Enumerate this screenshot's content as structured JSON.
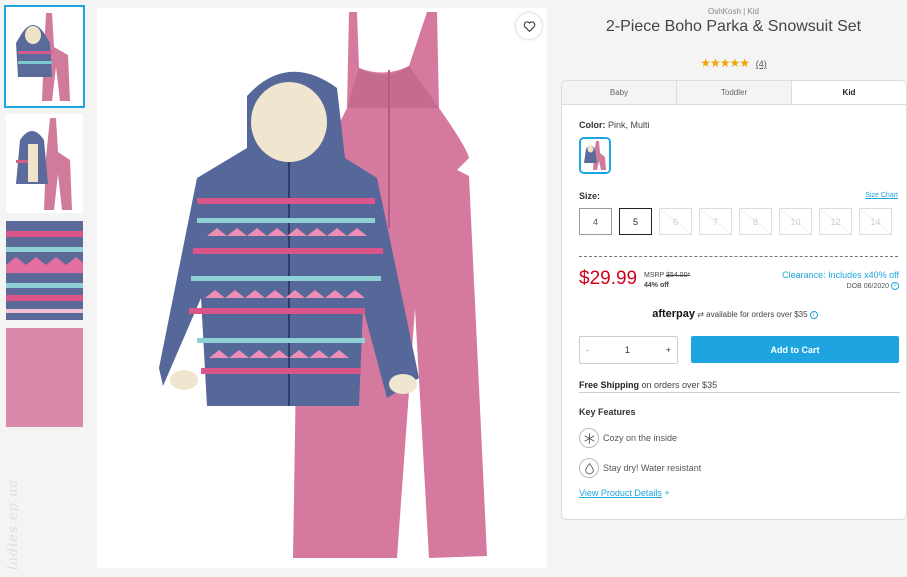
{
  "thumbnails": [
    {
      "label": "Parka and snowsuit front"
    },
    {
      "label": "Parka open with snowsuit"
    },
    {
      "label": "Parka print detail"
    },
    {
      "label": "Snowsuit fabric detail"
    }
  ],
  "watermark": "ladies.ep.ua",
  "product": {
    "brand": "OshKosh | Kid",
    "title": "2-Piece Boho Parka & Snowsuit Set",
    "stars": "★★★★★",
    "review_count": "(4)"
  },
  "tabs": [
    "Baby",
    "Toddler",
    "Kid"
  ],
  "active_tab": "Kid",
  "color": {
    "label": "Color:",
    "value": "Pink, Multi"
  },
  "size": {
    "label": "Size:",
    "chart_link": "Size Chart",
    "options": [
      {
        "label": "4",
        "state": "available"
      },
      {
        "label": "5",
        "state": "selected"
      },
      {
        "label": "6",
        "state": "unavailable"
      },
      {
        "label": "7",
        "state": "unavailable"
      },
      {
        "label": "8",
        "state": "unavailable"
      },
      {
        "label": "10",
        "state": "unavailable"
      },
      {
        "label": "12",
        "state": "unavailable"
      },
      {
        "label": "14",
        "state": "unavailable"
      }
    ]
  },
  "pricing": {
    "price": "$29.99",
    "msrp_label": "MSRP",
    "msrp_value": "$54.00*",
    "discount": "44% off",
    "clearance": "Clearance: Includes x40% off",
    "dob": "DOB 06/2020"
  },
  "afterpay": {
    "logo": "afterpay",
    "text": "available for orders over $35"
  },
  "quantity": {
    "minus": "-",
    "value": "1",
    "plus": "+"
  },
  "add_to_cart": "Add to Cart",
  "shipping": {
    "bold": "Free Shipping",
    "rest": "on orders over $35"
  },
  "key_features": {
    "title": "Key Features",
    "items": [
      {
        "icon": "snowflake-icon",
        "text": "Cozy on the inside"
      },
      {
        "icon": "water-drop-icon",
        "text": "Stay dry! Water resistant"
      }
    ]
  },
  "view_details": {
    "label": "View Product Details",
    "plus": "+"
  },
  "colors": {
    "accent": "#1ea5e0",
    "price": "#d0021b",
    "pink": "#d57a9e",
    "navy": "#4f5f8f"
  }
}
